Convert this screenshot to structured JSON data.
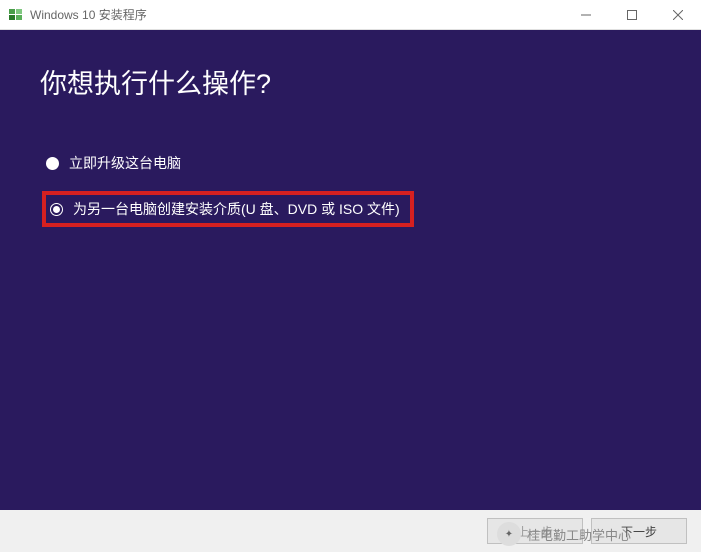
{
  "window": {
    "title": "Windows 10 安装程序"
  },
  "content": {
    "heading": "你想执行什么操作?",
    "option1": "立即升级这台电脑",
    "option2": "为另一台电脑创建安装介质(U 盘、DVD 或 ISO 文件)"
  },
  "footer": {
    "back_label": "上一步",
    "next_label": "下一步"
  },
  "watermark": {
    "text": "桂电勤工助学中心"
  }
}
